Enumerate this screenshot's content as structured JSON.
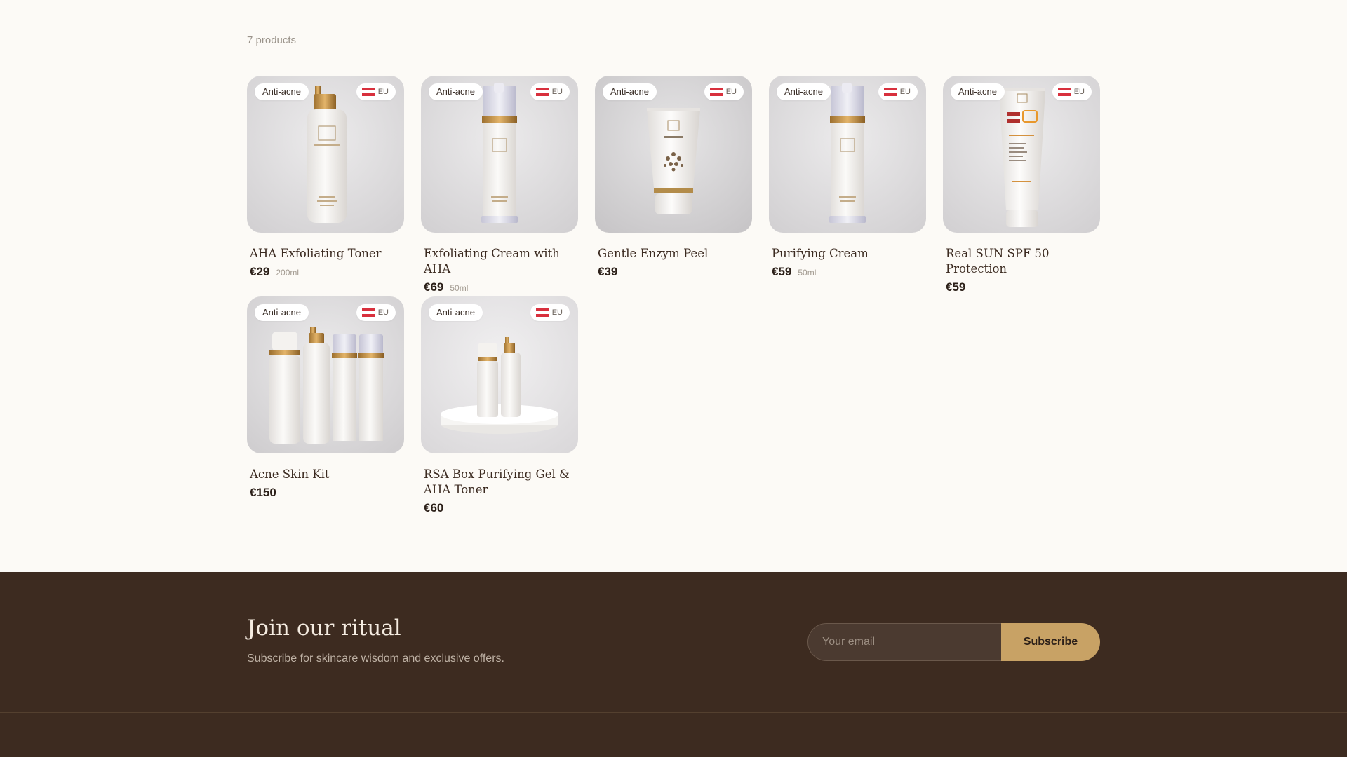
{
  "listing": {
    "count_label": "7 products",
    "products": [
      {
        "tag": "Anti-acne",
        "region": "EU",
        "name": "AHA Exfoliating Toner",
        "price": "€29",
        "size": "200ml"
      },
      {
        "tag": "Anti-acne",
        "region": "EU",
        "name": "Exfoliating Cream with AHA",
        "price": "€69",
        "size": "50ml"
      },
      {
        "tag": "Anti-acne",
        "region": "EU",
        "name": "Gentle Enzym Peel",
        "price": "€39",
        "size": ""
      },
      {
        "tag": "Anti-acne",
        "region": "EU",
        "name": "Purifying Cream",
        "price": "€59",
        "size": "50ml"
      },
      {
        "tag": "Anti-acne",
        "region": "EU",
        "name": "Real SUN SPF 50 Protection",
        "price": "€59",
        "size": ""
      },
      {
        "tag": "Anti-acne",
        "region": "EU",
        "name": "Acne Skin Kit",
        "price": "€150",
        "size": ""
      },
      {
        "tag": "Anti-acne",
        "region": "EU",
        "name": "RSA Box Purifying Gel & AHA Toner",
        "price": "€60",
        "size": ""
      }
    ]
  },
  "newsletter": {
    "title": "Join our ritual",
    "subtitle": "Subscribe for skincare wisdom and exclusive offers.",
    "email_placeholder": "Your email",
    "subscribe_label": "Subscribe"
  },
  "colors": {
    "page_bg": "#fcfaf6",
    "footer_bg": "#3d2b20",
    "accent_gold": "#c8a265",
    "flag_red": "#d8303d"
  },
  "icons": {
    "region_flag": "austria-flag-icon"
  }
}
